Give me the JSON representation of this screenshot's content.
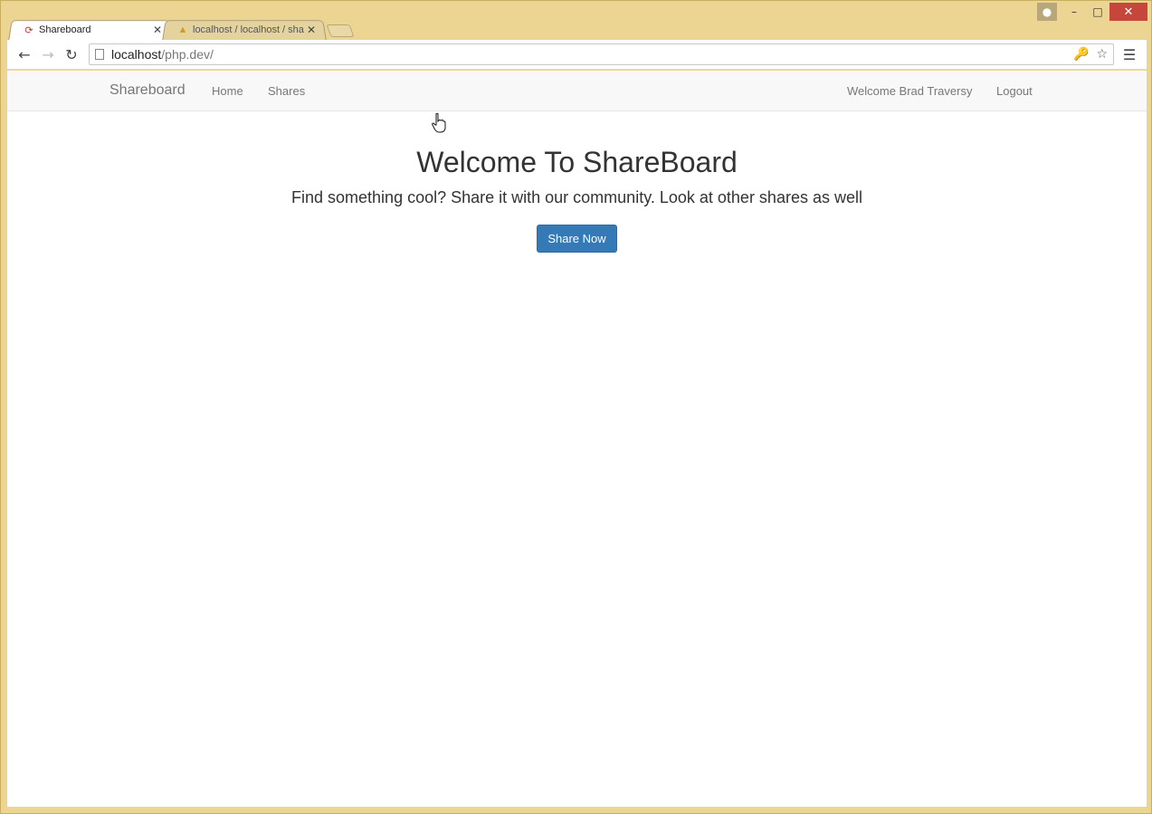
{
  "browser": {
    "tabs": [
      {
        "title": "Shareboard",
        "active": true,
        "favicon": "shareboard-logo-icon"
      },
      {
        "title": "localhost / localhost / sha",
        "active": false,
        "favicon": "phpmyadmin-icon"
      }
    ],
    "address": {
      "host": "localhost",
      "path": "/php.dev/"
    }
  },
  "site": {
    "brand": "Shareboard",
    "nav": {
      "home": "Home",
      "shares": "Shares",
      "welcome": "Welcome Brad Traversy",
      "logout": "Logout"
    }
  },
  "hero": {
    "title": "Welcome To ShareBoard",
    "subtitle": "Find something cool? Share it with our community. Look at other shares as well",
    "button": "Share Now"
  },
  "colors": {
    "primary": "#337ab7",
    "navbar_bg": "#f8f8f8",
    "frame": "#ecd493"
  }
}
